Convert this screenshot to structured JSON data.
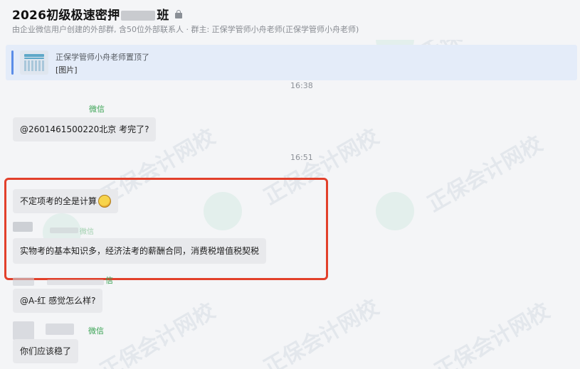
{
  "header": {
    "title_left": "2026初级极速密押",
    "title_right": "班",
    "subtitle": "由企业微信用户创建的外部群, 含50位外部联系人 · 群主: 正保学管师小舟老师(正保学管师小舟老师)"
  },
  "pinned": {
    "by": "正保学管师小舟老师置顶了",
    "content": "[图片]"
  },
  "times": [
    "16:38",
    "16:51"
  ],
  "messages": [
    {
      "sender": "微信",
      "text": "@2601461500220北京 考完了?"
    },
    {
      "text": "不定项考的全是计算"
    },
    {
      "sender": "微信",
      "text": "实物考的基本知识多，经济法考的薪酬合同，消费税增值税契税"
    },
    {
      "sender": "信",
      "text": "@A-红   感觉怎么样?"
    },
    {
      "sender": "微信",
      "text": "你们应该稳了"
    }
  ],
  "watermark": "正保会计网校"
}
